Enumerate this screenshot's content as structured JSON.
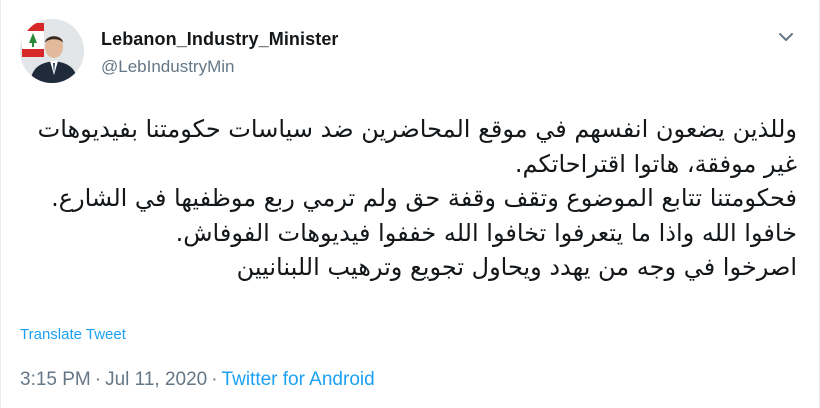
{
  "author": {
    "display_name": "Lebanon_Industry_Minister",
    "handle": "@LebIndustryMin",
    "avatar_icon": "profile-photo"
  },
  "tweet": {
    "lines": [
      "وللذين يضعون انفسهم في موقع المحاضرين ضد سياسات حكومتنا بفيديوهات",
      "غير موفقة، هاتوا اقتراحاتكم.",
      "فحكومتنا تتابع الموضوع وتقف وقفة حق ولم ترمي ربع موظفيها في الشارع.",
      "خافوا الله واذا ما يتعرفوا تخافوا الله خففوا فيديوهات الفوفاش.",
      "اصرخوا في وجه من يهدد ويحاول تجويع وترهيب اللبنانيين"
    ],
    "translate_label": "Translate Tweet"
  },
  "meta": {
    "time": "3:15 PM",
    "separator": "·",
    "date": "Jul 11, 2020",
    "source": "Twitter for Android"
  },
  "colors": {
    "link": "#1da1f2",
    "secondary_text": "#657786",
    "primary_text": "#14171a"
  },
  "icons": {
    "menu": "chevron-down-icon"
  }
}
